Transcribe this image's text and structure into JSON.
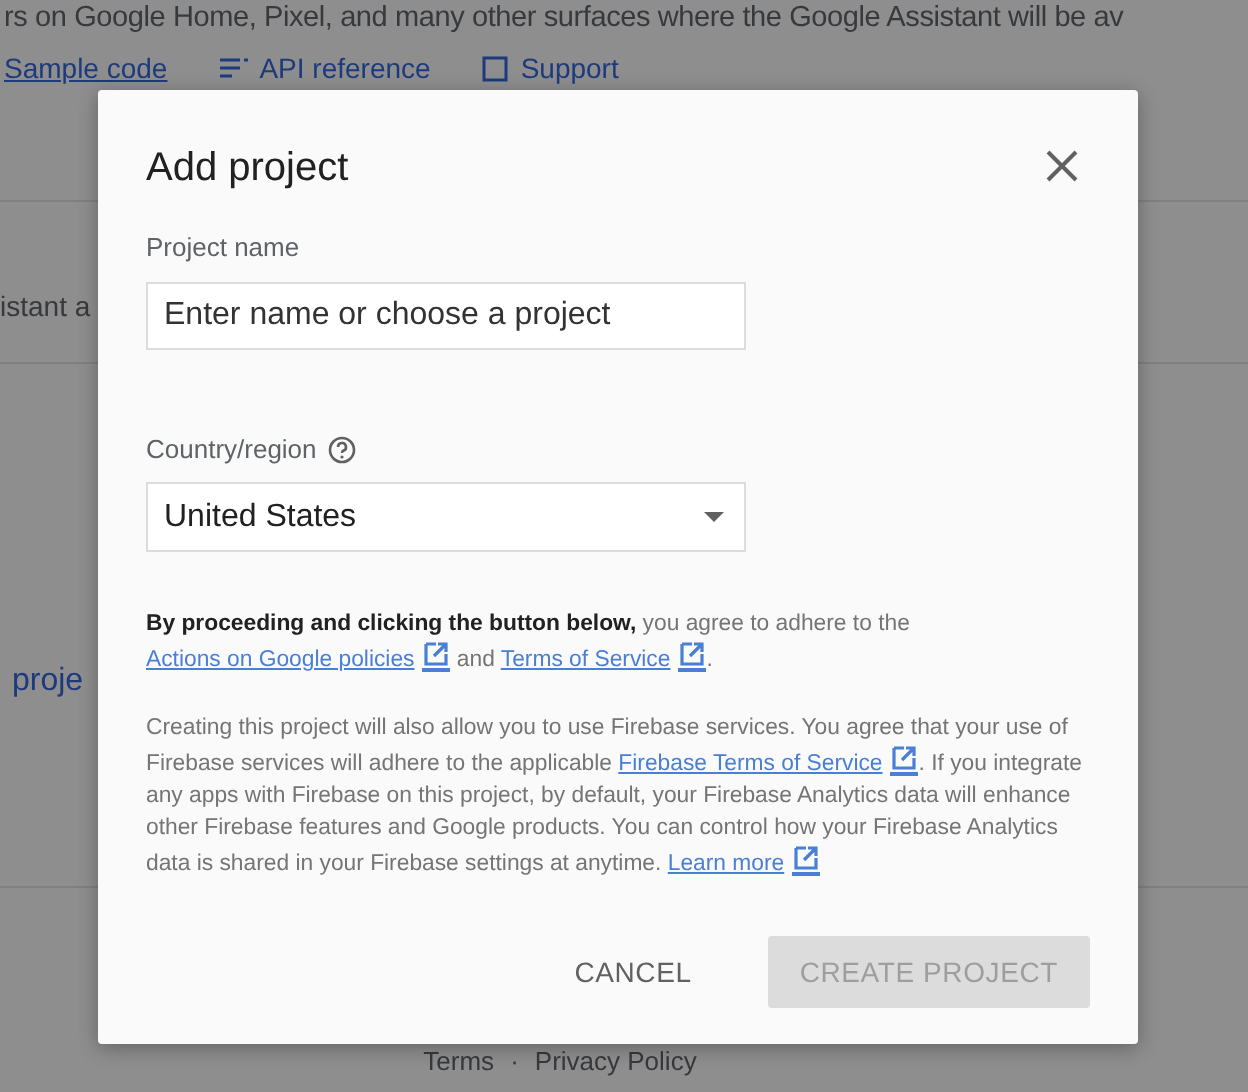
{
  "background": {
    "intro_text": "rs on Google Home, Pixel, and many other surfaces where the Google Assistant will be av",
    "links": [
      {
        "label": "Sample code"
      },
      {
        "label": "API reference"
      },
      {
        "label": "Support"
      }
    ],
    "section_text": "istant a",
    "project_link": "proje",
    "footer": {
      "links": [
        "Terms",
        "Privacy Policy"
      ],
      "separator": "·"
    }
  },
  "dialog": {
    "title": "Add project",
    "project_name": {
      "label": "Project name",
      "placeholder": "Enter name or choose a project"
    },
    "country": {
      "label": "Country/region",
      "value": "United States"
    },
    "paragraphs": [
      [
        {
          "kind": "bold",
          "text": "By proceeding and clicking the button below,"
        },
        {
          "kind": "plain",
          "text": " you agree to adhere to the "
        },
        {
          "kind": "link",
          "text": "Actions on Google policies"
        },
        {
          "kind": "plain",
          "text": " and "
        },
        {
          "kind": "link",
          "text": "Terms of Service"
        },
        {
          "kind": "plain",
          "text": "."
        }
      ],
      [
        {
          "kind": "plain",
          "text": "Creating this project will also allow you to use Firebase services. You agree that your use of Firebase services will adhere to the applicable "
        },
        {
          "kind": "link",
          "text": "Firebase Terms of Service"
        },
        {
          "kind": "plain",
          "text": ". If you integrate any apps with Firebase on this project, by default, your Firebase Analytics data will enhance other Firebase features and Google products. You can control how your Firebase Analytics data is shared in your Firebase settings at anytime. "
        },
        {
          "kind": "link",
          "text": "Learn more"
        }
      ]
    ],
    "buttons": [
      {
        "label": "CANCEL",
        "kind": "text",
        "disabled": false
      },
      {
        "label": "CREATE PROJECT",
        "kind": "raised",
        "disabled": true
      }
    ]
  }
}
